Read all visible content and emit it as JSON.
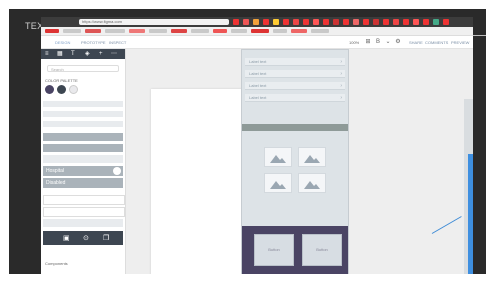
{
  "slide": {
    "title": "TEXT"
  },
  "browser": {
    "url": "https://www.figma.com",
    "toolbar": {
      "tabs": [
        "DESIGN",
        "PROTOTYPE",
        "INSPECT"
      ],
      "zoom": "100%",
      "right_links": [
        "SHARE",
        "COMMENTS",
        "PREVIEW"
      ]
    }
  },
  "left_panel": {
    "search_placeholder": "Search",
    "section_label": "COLOR PALETTE",
    "swatch_colors": [
      "#4a4464",
      "#3d4651",
      "#e9e9ec"
    ],
    "field_labels": [
      "Hospital",
      "Disabled"
    ],
    "footer_label": "Components"
  },
  "mobile": {
    "rows": [
      "Label text",
      "Label text",
      "Label text",
      "Label text"
    ],
    "buttons": [
      "Button",
      "Button"
    ]
  },
  "colors": {
    "accent_blue": "#3d8bd6",
    "purple": "#4a4464"
  }
}
